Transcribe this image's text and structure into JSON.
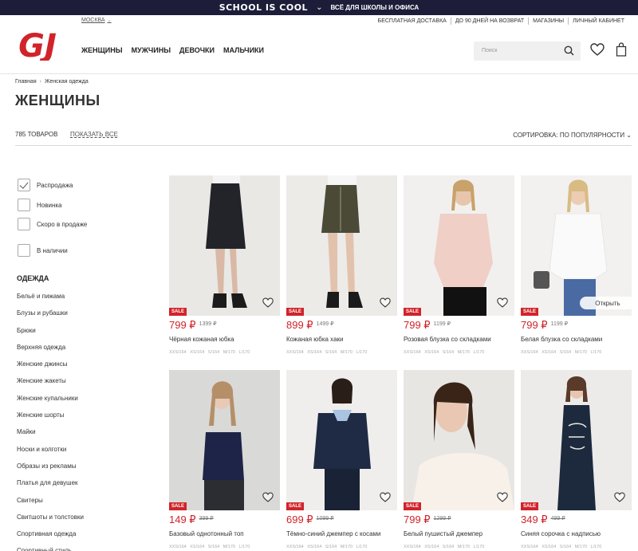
{
  "promo": {
    "title": "SCHOOL IS COOL",
    "subtitle": "ВСЁ ДЛЯ ШКОЛЫ И ОФИСА"
  },
  "header": {
    "city": "МОСКВА",
    "top_links": [
      "БЕСПЛАТНАЯ ДОСТАВКА",
      "ДО 90 ДНЕЙ НА ВОЗВРАТ",
      "МАГАЗИНЫ",
      "ЛИЧНЫЙ КАБИНЕТ"
    ],
    "logo_text": "GJ",
    "nav": [
      "ЖЕНЩИНЫ",
      "МУЖЧИНЫ",
      "ДЕВОЧКИ",
      "МАЛЬЧИКИ"
    ],
    "search_placeholder": "Поиск"
  },
  "breadcrumb": [
    "Главная",
    "Женская одежда"
  ],
  "page_title": "ЖЕНЩИНЫ",
  "toolbar": {
    "count": "785 ТОВАРОВ",
    "show_all": "ПОКАЗАТЬ ВСЕ",
    "sort": "СОРТИРОВКА: ПО ПОПУЛЯРНОСТИ"
  },
  "filters": [
    {
      "label": "Распродажа",
      "checked": true
    },
    {
      "label": "Новинка",
      "checked": false
    },
    {
      "label": "Скоро в продаже",
      "checked": false
    },
    {
      "label": "В наличии",
      "checked": false
    }
  ],
  "category_title": "ОДЕЖДА",
  "categories": [
    "Бельё и пижама",
    "Блузы и рубашки",
    "Брюки",
    "Верхняя одежда",
    "Женские джинсы",
    "Женские жакеты",
    "Женские купальники",
    "Женские шорты",
    "Майки",
    "Носки и колготки",
    "Образы из рекламы",
    "Платья для девушек",
    "Свитеры",
    "Свитшоты и толстовки",
    "Спортивная одежда",
    "Спортивный стиль"
  ],
  "colors": {
    "accent": "#d1232a",
    "promo_bg": "#1d1d3a"
  },
  "product_common": {
    "sale_badge": "SALE",
    "open_label": "Открыть",
    "sizes": "XXS/164  XS/164  S/164  M/170  L/170"
  },
  "products": [
    {
      "price": "799 ₽",
      "old_price": "1399 ₽",
      "old_strike": false,
      "name": "Чёрная кожаная юбка"
    },
    {
      "price": "899 ₽",
      "old_price": "1499 ₽",
      "old_strike": false,
      "name": "Кожаная юбка хаки"
    },
    {
      "price": "799 ₽",
      "old_price": "1199 ₽",
      "old_strike": false,
      "name": "Розовая блузка со складками"
    },
    {
      "price": "799 ₽",
      "old_price": "1199 ₽",
      "old_strike": false,
      "name": "Белая блузка со складками"
    },
    {
      "price": "149 ₽",
      "old_price": "399 ₽",
      "old_strike": true,
      "name": "Базовый однотонный топ"
    },
    {
      "price": "699 ₽",
      "old_price": "1099 ₽",
      "old_strike": true,
      "name": "Тёмно-синий джемпер с косами"
    },
    {
      "price": "799 ₽",
      "old_price": "1299 ₽",
      "old_strike": true,
      "name": "Белый пушистый джемпер"
    },
    {
      "price": "349 ₽",
      "old_price": "499 ₽",
      "old_strike": true,
      "name": "Синяя сорочка с надписью"
    }
  ]
}
